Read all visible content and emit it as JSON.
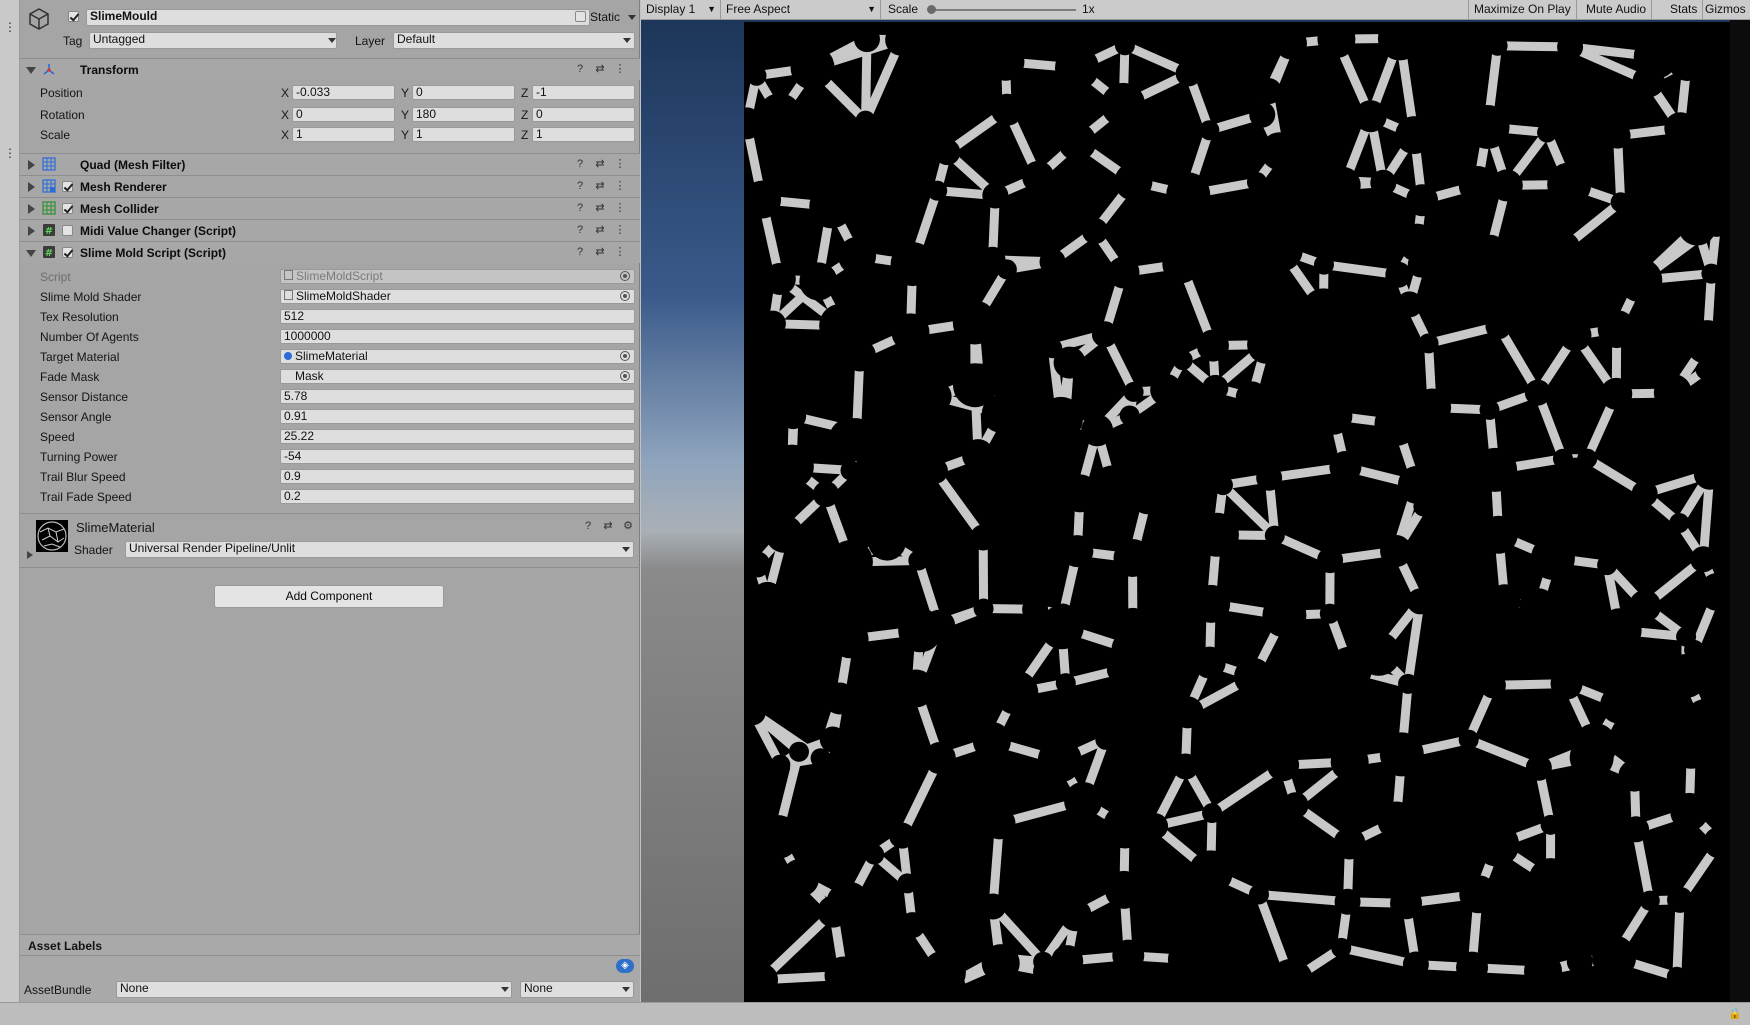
{
  "object": {
    "name": "SlimeMould",
    "static_label": "Static",
    "tag_label": "Tag",
    "tag_value": "Untagged",
    "layer_label": "Layer",
    "layer_value": "Default"
  },
  "transform": {
    "title": "Transform",
    "rows": [
      {
        "label": "Position",
        "x": "-0.033",
        "y": "0",
        "z": "-1"
      },
      {
        "label": "Rotation",
        "x": "0",
        "y": "180",
        "z": "0"
      },
      {
        "label": "Scale",
        "x": "1",
        "y": "1",
        "z": "1"
      }
    ],
    "axis_x": "X",
    "axis_y": "Y",
    "axis_z": "Z"
  },
  "components": [
    {
      "title": "Quad (Mesh Filter)",
      "icon": "mesh-filter-icon",
      "has_checkbox": false,
      "checked": false
    },
    {
      "title": "Mesh Renderer",
      "icon": "mesh-renderer-icon",
      "has_checkbox": true,
      "checked": true
    },
    {
      "title": "Mesh Collider",
      "icon": "mesh-collider-icon",
      "has_checkbox": true,
      "checked": true
    },
    {
      "title": "Midi Value Changer (Script)",
      "icon": "script-icon",
      "has_checkbox": true,
      "checked": false
    },
    {
      "title": "Slime Mold Script (Script)",
      "icon": "script-icon",
      "has_checkbox": true,
      "checked": true
    }
  ],
  "script_fields": [
    {
      "label": "Script",
      "value": "SlimeMoldScript",
      "kind": "object",
      "disabled": true
    },
    {
      "label": "Slime Mold Shader",
      "value": "SlimeMoldShader",
      "kind": "object",
      "disabled": false
    },
    {
      "label": "Tex Resolution",
      "value": "512",
      "kind": "text",
      "disabled": false
    },
    {
      "label": "Number Of Agents",
      "value": "1000000",
      "kind": "text",
      "disabled": false
    },
    {
      "label": "Target Material",
      "value": "SlimeMaterial",
      "kind": "object",
      "disabled": false
    },
    {
      "label": "Fade Mask",
      "value": "Mask",
      "kind": "object",
      "disabled": false
    },
    {
      "label": "Sensor Distance",
      "value": "5.78",
      "kind": "text",
      "disabled": false
    },
    {
      "label": "Sensor Angle",
      "value": "0.91",
      "kind": "text",
      "disabled": false
    },
    {
      "label": "Speed",
      "value": "25.22",
      "kind": "text",
      "disabled": false
    },
    {
      "label": "Turning Power",
      "value": "-54",
      "kind": "text",
      "disabled": false
    },
    {
      "label": "Trail Blur Speed",
      "value": "0.9",
      "kind": "text",
      "disabled": false
    },
    {
      "label": "Trail Fade Speed",
      "value": "0.2",
      "kind": "text",
      "disabled": false
    }
  ],
  "material": {
    "name": "SlimeMaterial",
    "shader_label": "Shader",
    "shader_value": "Universal Render Pipeline/Unlit"
  },
  "add_component_label": "Add Component",
  "asset_labels": {
    "title": "Asset Labels",
    "assetbundle_label": "AssetBundle",
    "bundle_value": "None",
    "variant_value": "None"
  },
  "game_toolbar": {
    "display": "Display 1",
    "aspect": "Free Aspect",
    "scale_label": "Scale",
    "scale_value": "1x",
    "scale_level": 0.0,
    "maximize": "Maximize On Play",
    "mute": "Mute Audio",
    "stats": "Stats",
    "gizmos": "Gizmos"
  },
  "colors": {
    "inspector_bg": "#a5a5a5",
    "field_bg": "#dedede",
    "slime_trail": "#c8c8c8",
    "slime_bg": "#000000",
    "sky_top": "#1d365a"
  }
}
